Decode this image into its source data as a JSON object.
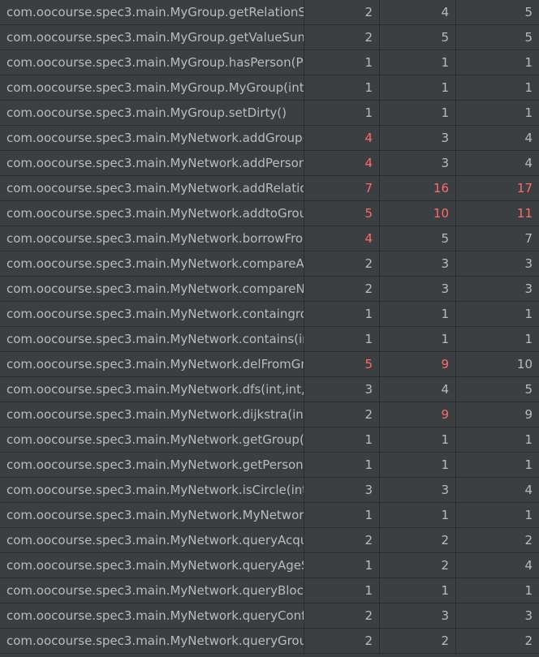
{
  "table": {
    "rows": [
      {
        "method": "com.oocourse.spec3.main.MyGroup.getRelationSu",
        "v1": "2",
        "v2": "4",
        "v3": "5",
        "r1": false,
        "r2": false,
        "r3": false
      },
      {
        "method": "com.oocourse.spec3.main.MyGroup.getValueSum",
        "v1": "2",
        "v2": "5",
        "v3": "5",
        "r1": false,
        "r2": false,
        "r3": false
      },
      {
        "method": "com.oocourse.spec3.main.MyGroup.hasPerson(Pe",
        "v1": "1",
        "v2": "1",
        "v3": "1",
        "r1": false,
        "r2": false,
        "r3": false
      },
      {
        "method": "com.oocourse.spec3.main.MyGroup.MyGroup(int)",
        "v1": "1",
        "v2": "1",
        "v3": "1",
        "r1": false,
        "r2": false,
        "r3": false
      },
      {
        "method": "com.oocourse.spec3.main.MyGroup.setDirty()",
        "v1": "1",
        "v2": "1",
        "v3": "1",
        "r1": false,
        "r2": false,
        "r3": false
      },
      {
        "method": "com.oocourse.spec3.main.MyNetwork.addGroup(",
        "v1": "4",
        "v2": "3",
        "v3": "4",
        "r1": true,
        "r2": false,
        "r3": false
      },
      {
        "method": "com.oocourse.spec3.main.MyNetwork.addPerson(",
        "v1": "4",
        "v2": "3",
        "v3": "4",
        "r1": true,
        "r2": false,
        "r3": false
      },
      {
        "method": "com.oocourse.spec3.main.MyNetwork.addRelation",
        "v1": "7",
        "v2": "16",
        "v3": "17",
        "r1": true,
        "r2": true,
        "r3": true
      },
      {
        "method": "com.oocourse.spec3.main.MyNetwork.addtoGrou",
        "v1": "5",
        "v2": "10",
        "v3": "11",
        "r1": true,
        "r2": true,
        "r3": true
      },
      {
        "method": "com.oocourse.spec3.main.MyNetwork.borrowFror",
        "v1": "4",
        "v2": "5",
        "v3": "7",
        "r1": true,
        "r2": false,
        "r3": false
      },
      {
        "method": "com.oocourse.spec3.main.MyNetwork.compareAg",
        "v1": "2",
        "v2": "3",
        "v3": "3",
        "r1": false,
        "r2": false,
        "r3": false
      },
      {
        "method": "com.oocourse.spec3.main.MyNetwork.compareNa",
        "v1": "2",
        "v2": "3",
        "v3": "3",
        "r1": false,
        "r2": false,
        "r3": false
      },
      {
        "method": "com.oocourse.spec3.main.MyNetwork.containgro",
        "v1": "1",
        "v2": "1",
        "v3": "1",
        "r1": false,
        "r2": false,
        "r3": false
      },
      {
        "method": "com.oocourse.spec3.main.MyNetwork.contains(int",
        "v1": "1",
        "v2": "1",
        "v3": "1",
        "r1": false,
        "r2": false,
        "r3": false
      },
      {
        "method": "com.oocourse.spec3.main.MyNetwork.delFromGro",
        "v1": "5",
        "v2": "9",
        "v3": "10",
        "r1": true,
        "r2": true,
        "r3": false
      },
      {
        "method": "com.oocourse.spec3.main.MyNetwork.dfs(int,int,H",
        "v1": "3",
        "v2": "4",
        "v3": "5",
        "r1": false,
        "r2": false,
        "r3": false
      },
      {
        "method": "com.oocourse.spec3.main.MyNetwork.dijkstra(int,",
        "v1": "2",
        "v2": "9",
        "v3": "9",
        "r1": false,
        "r2": true,
        "r3": false
      },
      {
        "method": "com.oocourse.spec3.main.MyNetwork.getGroup(i",
        "v1": "1",
        "v2": "1",
        "v3": "1",
        "r1": false,
        "r2": false,
        "r3": false
      },
      {
        "method": "com.oocourse.spec3.main.MyNetwork.getPerson(",
        "v1": "1",
        "v2": "1",
        "v3": "1",
        "r1": false,
        "r2": false,
        "r3": false
      },
      {
        "method": "com.oocourse.spec3.main.MyNetwork.isCircle(int,",
        "v1": "3",
        "v2": "3",
        "v3": "4",
        "r1": false,
        "r2": false,
        "r3": false
      },
      {
        "method": "com.oocourse.spec3.main.MyNetwork.MyNetwork",
        "v1": "1",
        "v2": "1",
        "v3": "1",
        "r1": false,
        "r2": false,
        "r3": false
      },
      {
        "method": "com.oocourse.spec3.main.MyNetwork.queryAcqu",
        "v1": "2",
        "v2": "2",
        "v3": "2",
        "r1": false,
        "r2": false,
        "r3": false
      },
      {
        "method": "com.oocourse.spec3.main.MyNetwork.queryAgeS",
        "v1": "1",
        "v2": "2",
        "v3": "4",
        "r1": false,
        "r2": false,
        "r3": false
      },
      {
        "method": "com.oocourse.spec3.main.MyNetwork.queryBlock",
        "v1": "1",
        "v2": "1",
        "v3": "1",
        "r1": false,
        "r2": false,
        "r3": false
      },
      {
        "method": "com.oocourse.spec3.main.MyNetwork.queryConfl",
        "v1": "2",
        "v2": "3",
        "v3": "3",
        "r1": false,
        "r2": false,
        "r3": false
      },
      {
        "method": "com.oocourse.spec3.main.MyNetwork.queryGroup",
        "v1": "2",
        "v2": "2",
        "v3": "2",
        "r1": false,
        "r2": false,
        "r3": false
      }
    ]
  },
  "colors": {
    "background": "#3c3f41",
    "grid": "#2b2b2b",
    "text": "#bbbbbb",
    "highlight": "#ff6b6b"
  }
}
